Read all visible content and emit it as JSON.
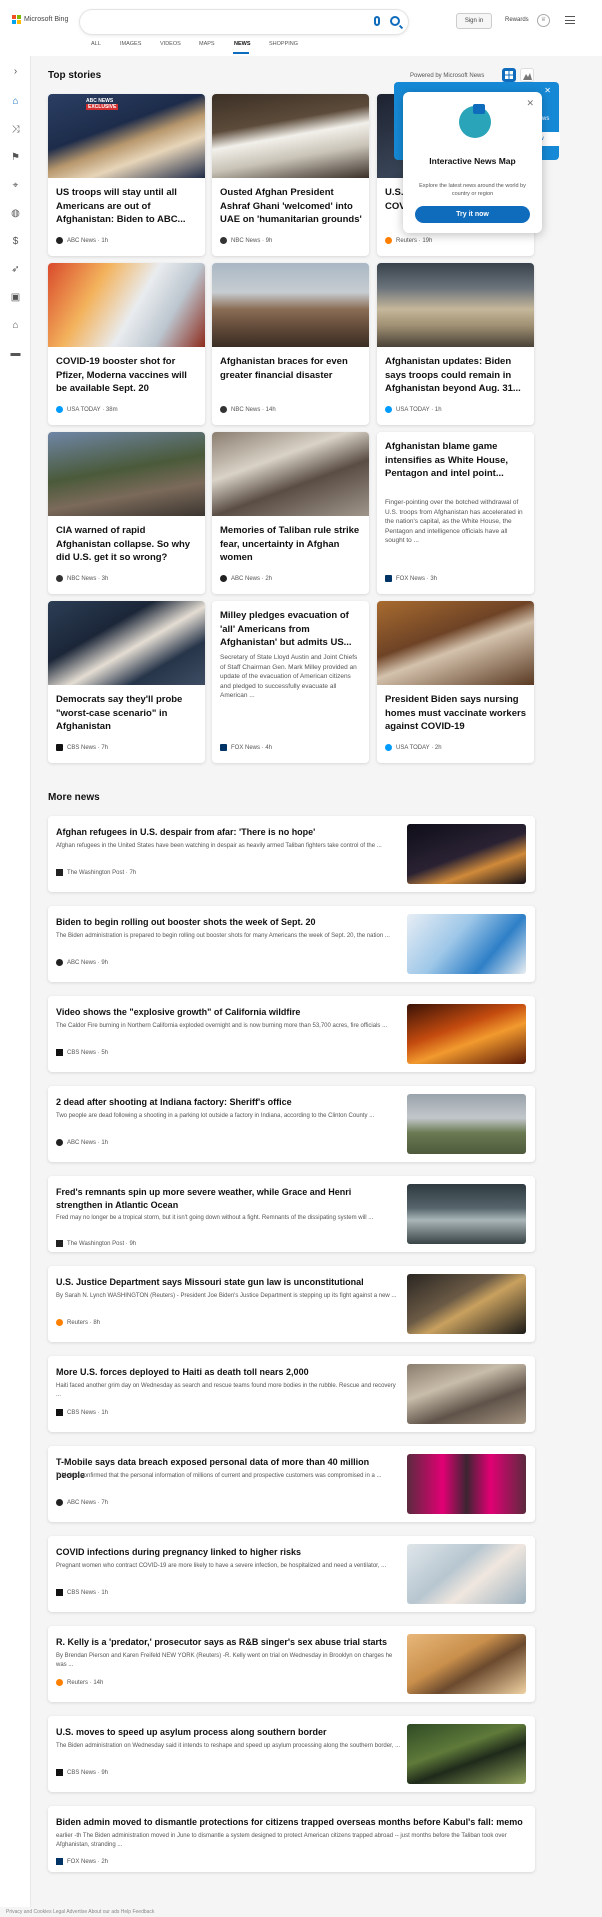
{
  "header": {
    "logo_text": "Microsoft Bing",
    "sign_in": "Sign in",
    "rewards": "Rewards",
    "tabs": [
      "ALL",
      "IMAGES",
      "VIDEOS",
      "MAPS",
      "NEWS",
      "SHOPPING"
    ],
    "active_tab": "NEWS"
  },
  "top_stories": {
    "title": "Top stories",
    "powered_by": "Powered by Microsoft News",
    "cards": [
      {
        "title": "US troops will stay until all Americans are out of Afghanistan: Biden to ABC...",
        "source": "ABC News · 1h"
      },
      {
        "title": "Ousted Afghan President Ashraf Ghani 'welcomed' into UAE on 'humanitarian grounds'",
        "source": "NBC News · 9h"
      },
      {
        "title": "U.S. COVI",
        "source": "Reuters · 19h"
      },
      {
        "title": "COVID-19 booster shot for Pfizer, Moderna vaccines will be available Sept. 20",
        "source": "USA TODAY · 38m"
      },
      {
        "title": "Afghanistan braces for even greater financial disaster",
        "source": "NBC News · 14h"
      },
      {
        "title": "Afghanistan updates: Biden says troops could remain in Afghanistan beyond Aug. 31...",
        "source": "USA TODAY · 1h"
      },
      {
        "title": "CIA warned of rapid Afghanistan collapse. So why did U.S. get it so wrong?",
        "source": "NBC News · 3h"
      },
      {
        "title": "Memories of Taliban rule strike fear, uncertainty in Afghan women",
        "source": "ABC News · 2h"
      },
      {
        "title": "Afghanistan blame game intensifies as White House, Pentagon and intel point...",
        "snippet": "Finger-pointing over the botched withdrawal of U.S. troops from Afghanistan has accelerated in the nation's capital, as the White House, the Pentagon and intelligence officials have all sought to ...",
        "source": "FOX News · 3h"
      },
      {
        "title": "Democrats say they'll probe \"worst-case scenario\" in Afghanistan",
        "source": "CBS News · 7h"
      },
      {
        "title": "Milley pledges evacuation of 'all' Americans from Afghanistan' but admits US...",
        "snippet": "Secretary of State Lloyd Austin and Joint Chiefs of Staff Chairman Gen. Mark Milley provided an update of the evacuation of American citizens and pledged to successfully evacuate all American ...",
        "source": "FOX News · 4h"
      },
      {
        "title": "President Biden says nursing homes must vaccinate workers against COVID-19",
        "source": "USA TODAY · 2h"
      }
    ],
    "badge_exclusive": "EXCLUSIVE",
    "badge_abc": "ABC NEWS"
  },
  "popup": {
    "title": "Interactive News Map",
    "description": "Explore the latest news around the world by country or region",
    "button": "Try it now",
    "behind_text": "ws",
    "behind_text2": "ow"
  },
  "more_news": {
    "title": "More news",
    "items": [
      {
        "title": "Afghan refugees in U.S. despair from afar: 'There is no hope'",
        "snippet": "Afghan refugees in the United States have been watching in despair as heavily armed Taliban fighters take control of the ...",
        "source": "The Washington Post · 7h"
      },
      {
        "title": "Biden to begin rolling out booster shots the week of Sept. 20",
        "snippet": "The Biden administration is prepared to begin rolling out booster shots for many Americans the week of Sept. 20, the nation ...",
        "source": "ABC News · 9h"
      },
      {
        "title": "Video shows the \"explosive growth\" of California wildfire",
        "snippet": "The Caldor Fire burning in Northern California exploded overnight and is now burning more than 53,700 acres, fire officials ...",
        "source": "CBS News · 5h"
      },
      {
        "title": "2 dead after shooting at Indiana factory: Sheriff's office",
        "snippet": "Two people are dead following a shooting in a parking lot outside a factory in Indiana, according to the Clinton County ...",
        "source": "ABC News · 1h"
      },
      {
        "title": "Fred's remnants spin up more severe weather, while Grace and Henri strengthen in Atlantic Ocean",
        "snippet": "Fred may no longer be a tropical storm, but it isn't going down without a fight. Remnants of the dissipating system will ...",
        "source": "The Washington Post · 9h"
      },
      {
        "title": "U.S. Justice Department says Missouri state gun law is unconstitutional",
        "snippet": "By Sarah N. Lynch WASHINGTON (Reuters) - President Joe Biden's Justice Department is stepping up its fight against a new ...",
        "source": "Reuters · 8h"
      },
      {
        "title": "More U.S. forces deployed to Haiti as death toll nears 2,000",
        "snippet": "Haiti faced another grim day on Wednesday as search and rescue teams found more bodies in the rubble. Rescue and recovery ...",
        "source": "CBS News · 1h"
      },
      {
        "title": "T-Mobile says data breach exposed personal data of more than 40 million people",
        "snippet": "T-Mobile confirmed that the personal information of millions of current and prospective customers was compromised in a ...",
        "source": "ABC News · 7h"
      },
      {
        "title": "COVID infections during pregnancy linked to higher risks",
        "snippet": "Pregnant women who contract COVID-19 are more likely to have a severe infection, be hospitalized and need a ventilator, ...",
        "source": "CBS News · 1h"
      },
      {
        "title": "R. Kelly is a 'predator,' prosecutor says as R&B singer's sex abuse trial starts",
        "snippet": "By Brendan Pierson and Karen Freifeld NEW YORK (Reuters) -R. Kelly went on trial on Wednesday in Brooklyn on charges he was ...",
        "source": "Reuters · 14h"
      },
      {
        "title": "U.S. moves to speed up asylum process along southern border",
        "snippet": "The Biden administration on Wednesday said it intends to reshape and speed up asylum processing along the southern border, ...",
        "source": "CBS News · 9h"
      },
      {
        "title": "Biden admin moved to dismantle protections for citizens trapped overseas months before Kabul's fall: memo",
        "snippet": "earlier -th The Biden administration moved in June to dismantle a system designed to protect American citizens trapped abroad -- just months before the Taliban took over Afghanistan, stranding ...",
        "source": "FOX News · 2h"
      }
    ]
  },
  "footer": {
    "text": "Privacy and Cookies  Legal  Advertise  About our ads  Help  Feedback"
  },
  "colors": {
    "accent": "#0f6cbd",
    "abc": "#1a1a1a",
    "nbc": "#333333",
    "reuters": "#ff8000",
    "usatoday": "#009bff",
    "fox": "#003366",
    "cbs": "#111111",
    "wapo": "#222222"
  }
}
